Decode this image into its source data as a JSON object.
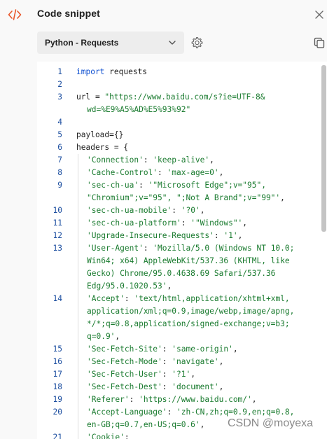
{
  "header": {
    "title": "Code snippet",
    "icon": "code-icon",
    "close_icon": "close-icon"
  },
  "toolbar": {
    "language": "Python - Requests",
    "settings_icon": "gear-icon",
    "copy_icon": "copy-icon"
  },
  "code": {
    "lines": [
      {
        "num": "1",
        "parts": [
          [
            "k",
            "import"
          ],
          [
            "t",
            " requests"
          ]
        ]
      },
      {
        "num": "2",
        "parts": []
      },
      {
        "num": "3",
        "parts": [
          [
            "t",
            "url = "
          ],
          [
            "s",
            "\"https://www.baidu.com/s?ie=UTF-8&"
          ]
        ]
      },
      {
        "num": "",
        "cont": true,
        "parts": [
          [
            "s",
            "wd=%E9%A5%AD%E5%93%92\""
          ]
        ]
      },
      {
        "num": "4",
        "parts": []
      },
      {
        "num": "5",
        "parts": [
          [
            "t",
            "payload={}"
          ]
        ]
      },
      {
        "num": "6",
        "parts": [
          [
            "t",
            "headers = {"
          ]
        ]
      },
      {
        "num": "7",
        "indent": true,
        "parts": [
          [
            "s",
            "'Connection'"
          ],
          [
            "t",
            ": "
          ],
          [
            "s",
            "'keep-alive'"
          ],
          [
            "t",
            ","
          ]
        ]
      },
      {
        "num": "8",
        "indent": true,
        "parts": [
          [
            "s",
            "'Cache-Control'"
          ],
          [
            "t",
            ": "
          ],
          [
            "s",
            "'max-age=0'"
          ],
          [
            "t",
            ","
          ]
        ]
      },
      {
        "num": "9",
        "indent": true,
        "parts": [
          [
            "s",
            "'sec-ch-ua'"
          ],
          [
            "t",
            ": "
          ],
          [
            "s",
            "'\"Microsoft Edge\";v=\"95\","
          ]
        ]
      },
      {
        "num": "",
        "cont": true,
        "parts": [
          [
            "s",
            "\"Chromium\";v=\"95\", \";Not A Brand\";v=\"99\"'"
          ],
          [
            "t",
            ","
          ]
        ]
      },
      {
        "num": "10",
        "indent": true,
        "parts": [
          [
            "s",
            "'sec-ch-ua-mobile'"
          ],
          [
            "t",
            ": "
          ],
          [
            "s",
            "'?0'"
          ],
          [
            "t",
            ","
          ]
        ]
      },
      {
        "num": "11",
        "indent": true,
        "parts": [
          [
            "s",
            "'sec-ch-ua-platform'"
          ],
          [
            "t",
            ": "
          ],
          [
            "s",
            "'\"Windows\"'"
          ],
          [
            "t",
            ","
          ]
        ]
      },
      {
        "num": "12",
        "indent": true,
        "parts": [
          [
            "s",
            "'Upgrade-Insecure-Requests'"
          ],
          [
            "t",
            ": "
          ],
          [
            "s",
            "'1'"
          ],
          [
            "t",
            ","
          ]
        ]
      },
      {
        "num": "13",
        "indent": true,
        "parts": [
          [
            "s",
            "'User-Agent'"
          ],
          [
            "t",
            ": "
          ],
          [
            "s",
            "'Mozilla/5.0 (Windows NT 10.0;"
          ]
        ]
      },
      {
        "num": "",
        "cont": true,
        "parts": [
          [
            "s",
            "Win64; x64) AppleWebKit/537.36 (KHTML, like"
          ]
        ]
      },
      {
        "num": "",
        "cont": true,
        "parts": [
          [
            "s",
            "Gecko) Chrome/95.0.4638.69 Safari/537.36"
          ]
        ]
      },
      {
        "num": "",
        "cont": true,
        "parts": [
          [
            "s",
            "Edg/95.0.1020.53'"
          ],
          [
            "t",
            ","
          ]
        ]
      },
      {
        "num": "14",
        "indent": true,
        "parts": [
          [
            "s",
            "'Accept'"
          ],
          [
            "t",
            ": "
          ],
          [
            "s",
            "'text/html,application/xhtml+xml,"
          ]
        ]
      },
      {
        "num": "",
        "cont": true,
        "parts": [
          [
            "s",
            "application/xml;q=0.9,image/webp,image/apng,"
          ]
        ]
      },
      {
        "num": "",
        "cont": true,
        "parts": [
          [
            "s",
            "*/*;q=0.8,application/signed-exchange;v=b3;"
          ]
        ]
      },
      {
        "num": "",
        "cont": true,
        "parts": [
          [
            "s",
            "q=0.9'"
          ],
          [
            "t",
            ","
          ]
        ]
      },
      {
        "num": "15",
        "indent": true,
        "parts": [
          [
            "s",
            "'Sec-Fetch-Site'"
          ],
          [
            "t",
            ": "
          ],
          [
            "s",
            "'same-origin'"
          ],
          [
            "t",
            ","
          ]
        ]
      },
      {
        "num": "16",
        "indent": true,
        "parts": [
          [
            "s",
            "'Sec-Fetch-Mode'"
          ],
          [
            "t",
            ": "
          ],
          [
            "s",
            "'navigate'"
          ],
          [
            "t",
            ","
          ]
        ]
      },
      {
        "num": "17",
        "indent": true,
        "parts": [
          [
            "s",
            "'Sec-Fetch-User'"
          ],
          [
            "t",
            ": "
          ],
          [
            "s",
            "'?1'"
          ],
          [
            "t",
            ","
          ]
        ]
      },
      {
        "num": "18",
        "indent": true,
        "parts": [
          [
            "s",
            "'Sec-Fetch-Dest'"
          ],
          [
            "t",
            ": "
          ],
          [
            "s",
            "'document'"
          ],
          [
            "t",
            ","
          ]
        ]
      },
      {
        "num": "19",
        "indent": true,
        "parts": [
          [
            "s",
            "'Referer'"
          ],
          [
            "t",
            ": "
          ],
          [
            "s",
            "'https://www.baidu.com/'"
          ],
          [
            "t",
            ","
          ]
        ]
      },
      {
        "num": "20",
        "indent": true,
        "parts": [
          [
            "s",
            "'Accept-Language'"
          ],
          [
            "t",
            ": "
          ],
          [
            "s",
            "'zh-CN,zh;q=0.9,en;q=0.8,"
          ]
        ]
      },
      {
        "num": "",
        "cont": true,
        "parts": [
          [
            "s",
            "en-GB;q=0.7,en-US;q=0.6'"
          ],
          [
            "t",
            ","
          ]
        ]
      },
      {
        "num": "21",
        "indent": true,
        "parts": [
          [
            "s",
            "'Cookie'"
          ],
          [
            "t",
            ":"
          ]
        ]
      }
    ]
  },
  "watermark": "CSDN @moyexa",
  "colors": {
    "keyword": "#0b4dd0",
    "string": "#1a7b2f",
    "line_number": "#1d4fa0",
    "accent": "#e8562a"
  }
}
